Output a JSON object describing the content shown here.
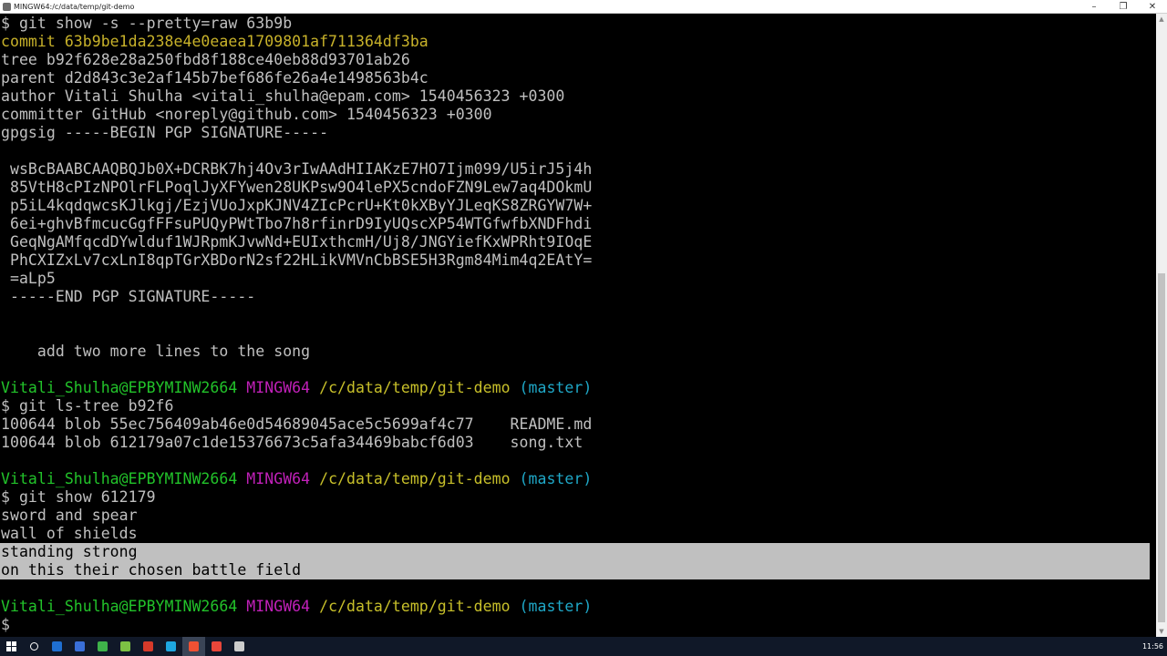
{
  "window": {
    "title": "MINGW64:/c/data/temp/git-demo",
    "minimize": "–",
    "maximize": "❐",
    "close": "✕"
  },
  "terminal": {
    "lines": [
      {
        "segments": [
          {
            "text": "$ git show -s --pretty=raw 63b9b",
            "color": "default"
          }
        ]
      },
      {
        "segments": [
          {
            "text": "commit 63b9be1da238e4e0eaea1709801af711364df3ba",
            "color": "yellow"
          }
        ]
      },
      {
        "segments": [
          {
            "text": "tree b92f628e28a250fbd8f188ce40eb88d93701ab26",
            "color": "default"
          }
        ]
      },
      {
        "segments": [
          {
            "text": "parent d2d843c3e2af145b7bef686fe26a4e1498563b4c",
            "color": "default"
          }
        ]
      },
      {
        "segments": [
          {
            "text": "author Vitali Shulha <vitali_shulha@epam.com> 1540456323 +0300",
            "color": "default"
          }
        ]
      },
      {
        "segments": [
          {
            "text": "committer GitHub <noreply@github.com> 1540456323 +0300",
            "color": "default"
          }
        ]
      },
      {
        "segments": [
          {
            "text": "gpgsig -----BEGIN PGP SIGNATURE-----",
            "color": "default"
          }
        ]
      },
      {
        "segments": [
          {
            "text": "",
            "color": "default"
          }
        ]
      },
      {
        "segments": [
          {
            "text": " wsBcBAABCAAQBQJb0X+DCRBK7hj4Ov3rIwAAdHIIAKzE7HO7Ijm099/U5irJ5j4h",
            "color": "default"
          }
        ]
      },
      {
        "segments": [
          {
            "text": " 85VtH8cPIzNPOlrFLPoqlJyXFYwen28UKPsw9O4lePX5cndoFZN9Lew7aq4DOkmU",
            "color": "default"
          }
        ]
      },
      {
        "segments": [
          {
            "text": " p5iL4kqdqwcsKJlkgj/EzjVUoJxpKJNV4ZIcPcrU+Kt0kXByYJLeqKS8ZRGYW7W+",
            "color": "default"
          }
        ]
      },
      {
        "segments": [
          {
            "text": " 6ei+ghvBfmcucGgfFFsuPUQyPWtTbo7h8rfinrD9IyUQscXP54WTGfwfbXNDFhdi",
            "color": "default"
          }
        ]
      },
      {
        "segments": [
          {
            "text": " GeqNgAMfqcdDYwlduf1WJRpmKJvwNd+EUIxthcmH/Uj8/JNGYiefKxWPRht9IOqE",
            "color": "default"
          }
        ]
      },
      {
        "segments": [
          {
            "text": " PhCXIZxLv7cxLnI8qpTGrXBDorN2sf22HLikVMVnCbBSE5H3Rgm84Mim4q2EAtY=",
            "color": "default"
          }
        ]
      },
      {
        "segments": [
          {
            "text": " =aLp5",
            "color": "default"
          }
        ]
      },
      {
        "segments": [
          {
            "text": " -----END PGP SIGNATURE-----",
            "color": "default"
          }
        ]
      },
      {
        "segments": [
          {
            "text": "",
            "color": "default"
          }
        ]
      },
      {
        "segments": [
          {
            "text": "",
            "color": "default"
          }
        ]
      },
      {
        "segments": [
          {
            "text": "    add two more lines to the song",
            "color": "default"
          }
        ]
      },
      {
        "segments": [
          {
            "text": "",
            "color": "default"
          }
        ]
      },
      {
        "segments": [
          {
            "text": "Vitali_Shulha@EPBYMINW2664 ",
            "color": "green"
          },
          {
            "text": "MINGW64 ",
            "color": "magenta"
          },
          {
            "text": "/c/data/temp/git-demo ",
            "color": "yel2"
          },
          {
            "text": "(master)",
            "color": "cyan"
          }
        ]
      },
      {
        "segments": [
          {
            "text": "$ git ls-tree b92f6",
            "color": "default"
          }
        ]
      },
      {
        "segments": [
          {
            "text": "100644 blob 55ec756409ab46e0d54689045ace5c5699af4c77    README.md",
            "color": "default"
          }
        ]
      },
      {
        "segments": [
          {
            "text": "100644 blob 612179a07c1de15376673c5afa34469babcf6d03    song.txt",
            "color": "default"
          }
        ]
      },
      {
        "segments": [
          {
            "text": "",
            "color": "default"
          }
        ]
      },
      {
        "segments": [
          {
            "text": "Vitali_Shulha@EPBYMINW2664 ",
            "color": "green"
          },
          {
            "text": "MINGW64 ",
            "color": "magenta"
          },
          {
            "text": "/c/data/temp/git-demo ",
            "color": "yel2"
          },
          {
            "text": "(master)",
            "color": "cyan"
          }
        ]
      },
      {
        "segments": [
          {
            "text": "$ git show 612179",
            "color": "default"
          }
        ]
      },
      {
        "segments": [
          {
            "text": "sword and spear",
            "color": "default"
          }
        ]
      },
      {
        "segments": [
          {
            "text": "wall of shields",
            "color": "default"
          }
        ]
      },
      {
        "segments": [
          {
            "text": "standing strong",
            "color": "sel"
          }
        ]
      },
      {
        "segments": [
          {
            "text": "on this their chosen battle field",
            "color": "sel"
          }
        ]
      },
      {
        "segments": [
          {
            "text": "",
            "color": "default"
          }
        ]
      },
      {
        "segments": [
          {
            "text": "Vitali_Shulha@EPBYMINW2664 ",
            "color": "green"
          },
          {
            "text": "MINGW64 ",
            "color": "magenta"
          },
          {
            "text": "/c/data/temp/git-demo ",
            "color": "yel2"
          },
          {
            "text": "(master)",
            "color": "cyan"
          }
        ]
      },
      {
        "segments": [
          {
            "text": "$ ",
            "color": "default"
          }
        ]
      }
    ]
  },
  "taskbar": {
    "items": [
      {
        "name": "start-button-icon",
        "color": "#ffffff",
        "active": false
      },
      {
        "name": "search-icon",
        "color": "#ffffff",
        "active": false
      },
      {
        "name": "outlook-icon",
        "color": "#1f6fd1",
        "active": false
      },
      {
        "name": "save-icon",
        "color": "#3a6fd8",
        "active": false
      },
      {
        "name": "app-green-icon",
        "color": "#3fb24a",
        "active": false
      },
      {
        "name": "notepad-icon",
        "color": "#7dc144",
        "active": false
      },
      {
        "name": "pdf-icon",
        "color": "#d63a2a",
        "active": false
      },
      {
        "name": "skype-icon",
        "color": "#1ea7e1",
        "active": false
      },
      {
        "name": "git-bash-icon",
        "color": "#f05133",
        "active": true
      },
      {
        "name": "chrome-icon",
        "color": "#e8463a",
        "active": false
      },
      {
        "name": "settings-icon",
        "color": "#cccccc",
        "active": false
      }
    ],
    "clock": "11:56"
  },
  "colors": {
    "default": "#c0c0c0",
    "yellow": "#c8b22a",
    "green": "#22c32a",
    "magenta": "#c020b8",
    "yel2": "#c8c02a",
    "cyan": "#1fa8c8",
    "selection": "#c0c0c0"
  }
}
